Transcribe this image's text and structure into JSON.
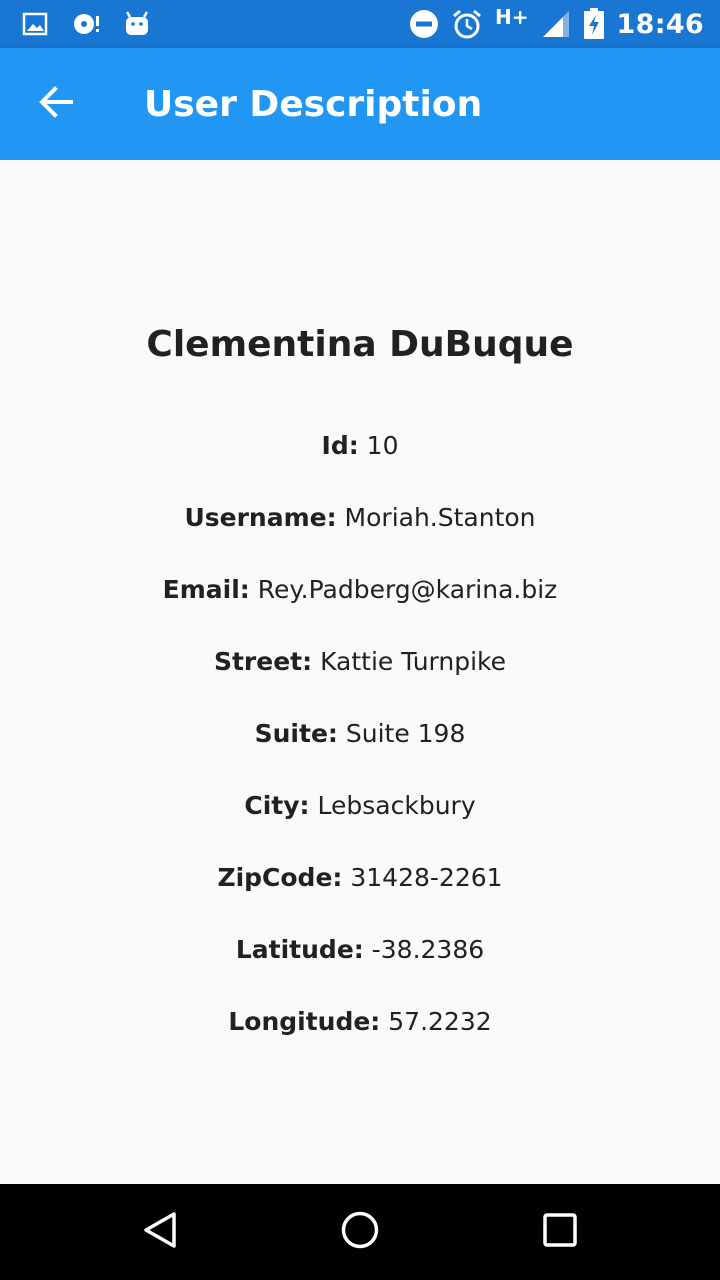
{
  "status_bar": {
    "time": "18:46",
    "network": "H+",
    "icons": [
      "image-icon",
      "disc-icon",
      "android-icon",
      "do-not-disturb-icon",
      "alarm-icon",
      "signal-icon",
      "battery-charging-icon"
    ]
  },
  "app_bar": {
    "title": "User Description",
    "back_icon": "arrow-back-icon",
    "color": "#2196f3"
  },
  "user": {
    "name": "Clementina DuBuque",
    "fields": [
      {
        "label": "Id:",
        "value": "10"
      },
      {
        "label": "Username:",
        "value": "Moriah.Stanton"
      },
      {
        "label": "Email:",
        "value": "Rey.Padberg@karina.biz"
      },
      {
        "label": "Street:",
        "value": "Kattie Turnpike"
      },
      {
        "label": "Suite:",
        "value": "Suite 198"
      },
      {
        "label": "City:",
        "value": "Lebsackbury"
      },
      {
        "label": "ZipCode:",
        "value": "31428-2261"
      },
      {
        "label": "Latitude:",
        "value": "-38.2386"
      },
      {
        "label": "Longitude:",
        "value": "57.2232"
      }
    ]
  },
  "nav_bar": {
    "buttons": [
      "back-triangle-icon",
      "home-circle-icon",
      "recents-square-icon"
    ]
  }
}
